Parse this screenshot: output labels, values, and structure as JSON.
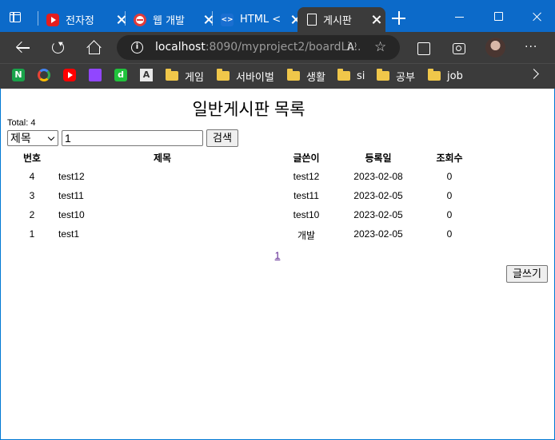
{
  "browser": {
    "tabs": [
      {
        "label": "전자정"
      },
      {
        "label": "웹 개발"
      },
      {
        "label": "HTML <"
      },
      {
        "label": "게시판"
      }
    ],
    "url": {
      "host": "localhost",
      "rest": ":8090/myproject2/boardLi..."
    },
    "favorites": [
      {
        "label": "게임"
      },
      {
        "label": "서바이벌"
      },
      {
        "label": "생활"
      },
      {
        "label": "si"
      },
      {
        "label": "공부"
      },
      {
        "label": "job"
      }
    ],
    "fav_icon_text": {
      "n": "N",
      "d": "d",
      "a": "A"
    },
    "read_aloud": "A⁾",
    "more": "···"
  },
  "page": {
    "title": "일반게시판 목록",
    "total": "Total: 4",
    "search": {
      "field": "제목",
      "value": "1",
      "button": "검색"
    },
    "headers": {
      "no": "번호",
      "title": "제목",
      "writer": "글쓴이",
      "date": "등록일",
      "views": "조회수"
    },
    "rows": [
      {
        "no": "4",
        "title": "test12",
        "writer": "test12",
        "date": "2023-02-08",
        "views": "0"
      },
      {
        "no": "3",
        "title": "test11",
        "writer": "test11",
        "date": "2023-02-05",
        "views": "0"
      },
      {
        "no": "2",
        "title": "test10",
        "writer": "test10",
        "date": "2023-02-05",
        "views": "0"
      },
      {
        "no": "1",
        "title": "test1",
        "writer": "개발",
        "date": "2023-02-05",
        "views": "0"
      }
    ],
    "page_link": "1",
    "write_button": "글쓰기"
  }
}
